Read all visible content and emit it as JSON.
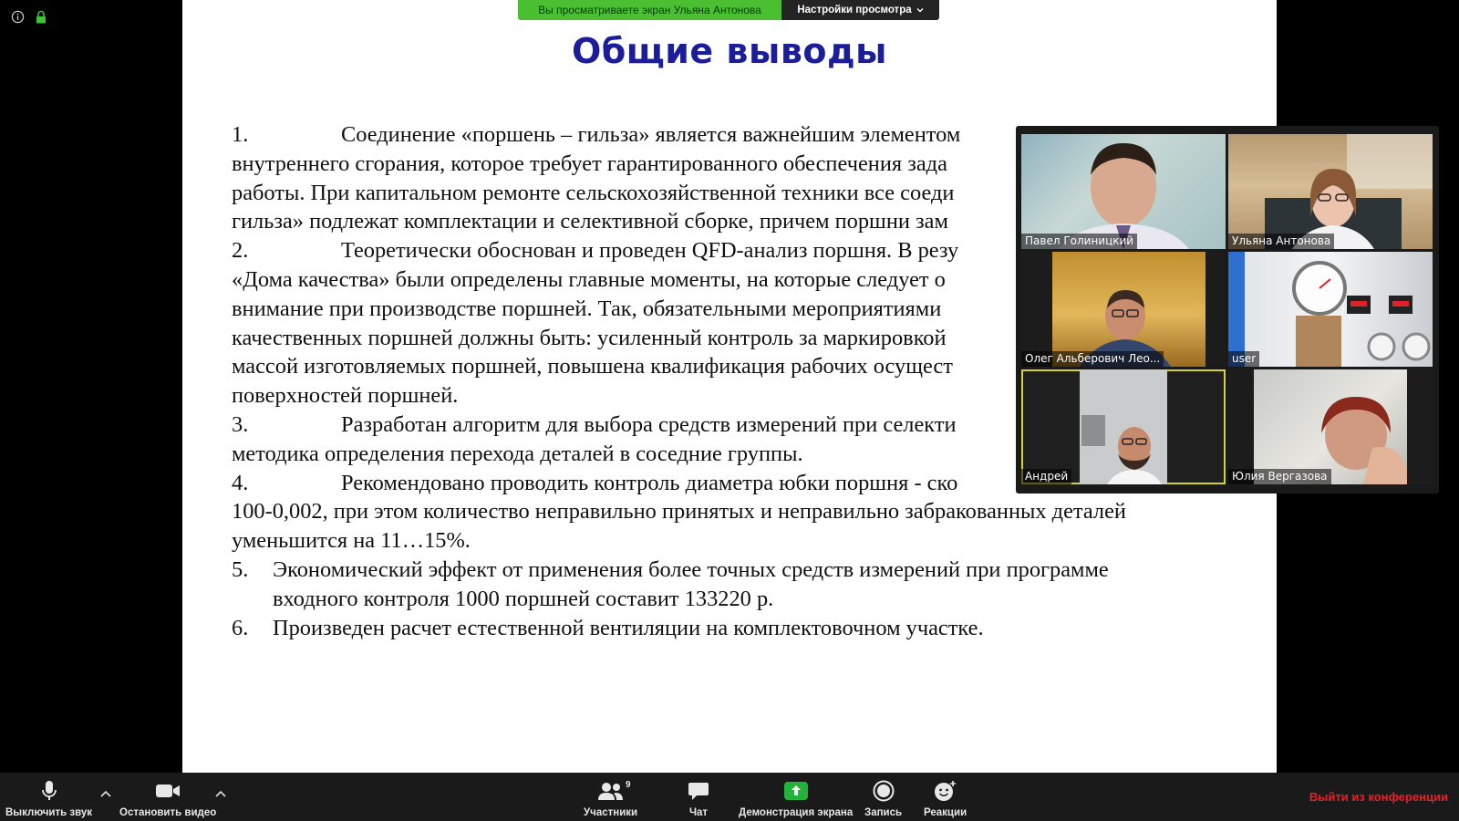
{
  "top_icons": [
    "info-icon",
    "lock-icon"
  ],
  "share_banner": {
    "viewing_text": "Вы просматриваете экран Ульяна Антонова",
    "view_options_label": "Настройки просмотра"
  },
  "slide": {
    "title": "Общие выводы",
    "items": [
      {
        "number": "1.",
        "lines": [
          "Соединение «поршень – гильза» является важнейшим элементом",
          "внутреннего сгорания, которое требует гарантированного обеспечения зада",
          "работы. При капитальном ремонте сельскохозяйственной техники все соеди",
          "гильза» подлежат комплектации и селективной сборке, причем поршни зам"
        ]
      },
      {
        "number": "2.",
        "lines": [
          "Теоретически обоснован и проведен QFD-анализ поршня. В резу",
          "«Дома качества» были определены главные моменты, на которые следует о",
          "внимание при производстве поршней. Так, обязательными мероприятиями",
          "качественных поршней должны быть: усиленный контроль за маркировкой",
          "массой изготовляемых поршней, повышена квалификация рабочих осущест",
          "поверхностей поршней."
        ]
      },
      {
        "number": "3.",
        "lines": [
          "Разработан алгоритм для выбора средств измерений при селекти",
          "методика определения перехода деталей в соседние группы."
        ]
      },
      {
        "number": "4.",
        "lines": [
          "Рекомендовано проводить контроль диаметра юбки поршня - ско",
          "100-0,002, при этом количество неправильно принятых и неправильно забракованных деталей",
          "уменьшится на 11…15%."
        ]
      },
      {
        "number": "5.",
        "lines": [
          "Экономический эффект от применения более точных средств измерений при программе",
          "входного контроля 1000 поршней составит 133220 р."
        ]
      },
      {
        "number": "6.",
        "lines": [
          "Произведен расчет естественной вентиляции на комплектовочном участке."
        ]
      }
    ]
  },
  "participants": [
    {
      "name": "Павел Голиницкий",
      "active": false
    },
    {
      "name": "Ульяна Антонова",
      "active": false
    },
    {
      "name": "Олег Альберович Лео...",
      "active": false
    },
    {
      "name": "user",
      "active": false
    },
    {
      "name": "Андрей",
      "active": true
    },
    {
      "name": "Юлия Вергазова",
      "active": false
    }
  ],
  "toolbar": {
    "mute_label": "Выключить звук",
    "video_label": "Остановить видео",
    "participants_label": "Участники",
    "participants_count": "9",
    "chat_label": "Чат",
    "share_label": "Демонстрация экрана",
    "record_label": "Запись",
    "reactions_label": "Реакции",
    "leave_label": "Выйти из конференции"
  },
  "colors": {
    "title_blue": "#1b1e98",
    "banner_green": "#4bbf32",
    "leave_red": "#e8202a",
    "share_green": "#23b33b",
    "active_speaker": "#d6d23a"
  }
}
